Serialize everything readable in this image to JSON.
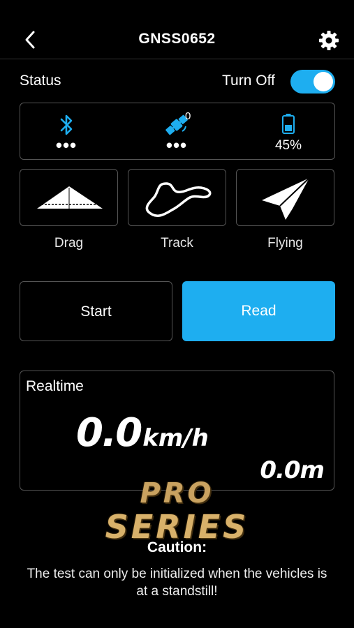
{
  "header": {
    "title": "GNSS0652"
  },
  "status": {
    "label": "Status",
    "toggle_label": "Turn Off",
    "toggle_on": true
  },
  "indicators": {
    "bluetooth": {
      "value": "•••",
      "icon": "bluetooth-icon"
    },
    "satellite": {
      "count": "0",
      "value": "•••",
      "icon": "satellite-icon"
    },
    "battery": {
      "value": "45%",
      "icon": "battery-icon"
    }
  },
  "modes": [
    {
      "label": "Drag",
      "icon": "drag-strip-icon"
    },
    {
      "label": "Track",
      "icon": "race-track-icon"
    },
    {
      "label": "Flying",
      "icon": "paper-plane-icon"
    }
  ],
  "actions": {
    "start_label": "Start",
    "read_label": "Read"
  },
  "realtime": {
    "label": "Realtime",
    "speed": "0.0",
    "speed_unit": "km/h",
    "distance": "0.0m"
  },
  "watermark": {
    "line1": "PRO",
    "line2": "SERIES"
  },
  "caution": {
    "title": "Caution:",
    "text": "The test can only be initialized when the vehicles is at a standstill!"
  },
  "colors": {
    "accent": "#1eaef0",
    "background": "#000000",
    "border": "#555555"
  }
}
